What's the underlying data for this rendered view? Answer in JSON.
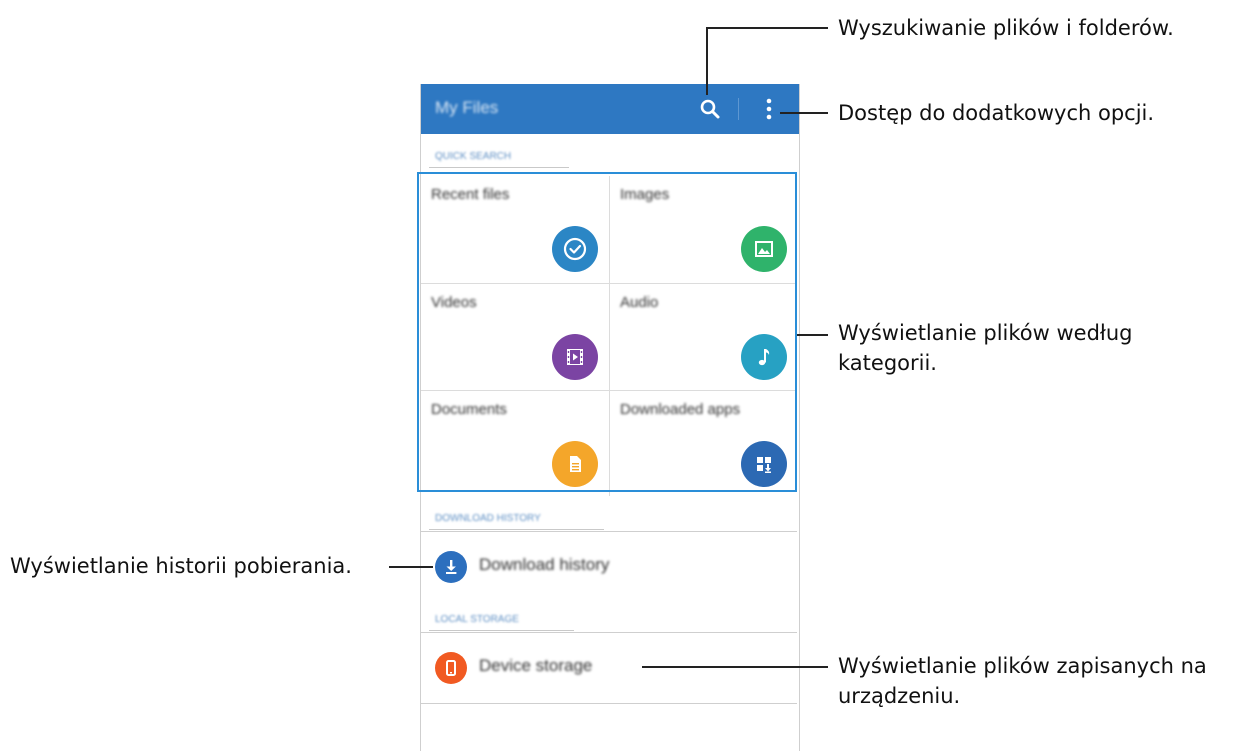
{
  "app": {
    "title": "My Files",
    "search_icon": "search-icon",
    "more_icon": "more-vertical-icon"
  },
  "sections": {
    "quick_search": "QUICK SEARCH",
    "download_history": "DOWNLOAD HISTORY",
    "local_storage": "LOCAL STORAGE"
  },
  "categories": [
    {
      "label": "Recent files",
      "icon": "clock-check-icon",
      "color": "#2b86c5"
    },
    {
      "label": "Images",
      "icon": "image-icon",
      "color": "#2fb36b"
    },
    {
      "label": "Videos",
      "icon": "film-icon",
      "color": "#7b44a3"
    },
    {
      "label": "Audio",
      "icon": "music-note-icon",
      "color": "#27a1c3"
    },
    {
      "label": "Documents",
      "icon": "document-icon",
      "color": "#f4a62a"
    },
    {
      "label": "Downloaded apps",
      "icon": "apps-download-icon",
      "color": "#2c69b3"
    }
  ],
  "rows": {
    "download_history": {
      "label": "Download history",
      "icon": "download-icon",
      "color": "#2c6fbe"
    },
    "device_storage": {
      "label": "Device storage",
      "icon": "phone-icon",
      "color": "#f15a22"
    }
  },
  "annotations": {
    "search": "Wyszukiwanie plików i folderów.",
    "more": "Dostęp do dodatkowych opcji.",
    "categories_line1": "Wyświetlanie plików według",
    "categories_line2": "kategorii.",
    "history": "Wyświetlanie historii pobierania.",
    "storage_line1": "Wyświetlanie plików zapisanych na",
    "storage_line2": "urządzeniu."
  }
}
